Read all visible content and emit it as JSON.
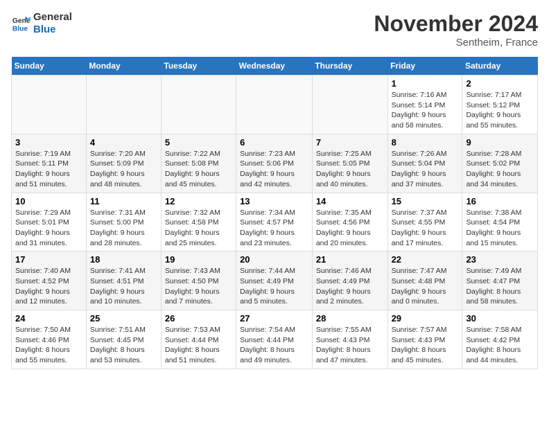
{
  "logo": {
    "line1": "General",
    "line2": "Blue"
  },
  "title": "November 2024",
  "location": "Sentheim, France",
  "days_of_week": [
    "Sunday",
    "Monday",
    "Tuesday",
    "Wednesday",
    "Thursday",
    "Friday",
    "Saturday"
  ],
  "weeks": [
    [
      {
        "num": "",
        "info": ""
      },
      {
        "num": "",
        "info": ""
      },
      {
        "num": "",
        "info": ""
      },
      {
        "num": "",
        "info": ""
      },
      {
        "num": "",
        "info": ""
      },
      {
        "num": "1",
        "info": "Sunrise: 7:16 AM\nSunset: 5:14 PM\nDaylight: 9 hours and 58 minutes."
      },
      {
        "num": "2",
        "info": "Sunrise: 7:17 AM\nSunset: 5:12 PM\nDaylight: 9 hours and 55 minutes."
      }
    ],
    [
      {
        "num": "3",
        "info": "Sunrise: 7:19 AM\nSunset: 5:11 PM\nDaylight: 9 hours and 51 minutes."
      },
      {
        "num": "4",
        "info": "Sunrise: 7:20 AM\nSunset: 5:09 PM\nDaylight: 9 hours and 48 minutes."
      },
      {
        "num": "5",
        "info": "Sunrise: 7:22 AM\nSunset: 5:08 PM\nDaylight: 9 hours and 45 minutes."
      },
      {
        "num": "6",
        "info": "Sunrise: 7:23 AM\nSunset: 5:06 PM\nDaylight: 9 hours and 42 minutes."
      },
      {
        "num": "7",
        "info": "Sunrise: 7:25 AM\nSunset: 5:05 PM\nDaylight: 9 hours and 40 minutes."
      },
      {
        "num": "8",
        "info": "Sunrise: 7:26 AM\nSunset: 5:04 PM\nDaylight: 9 hours and 37 minutes."
      },
      {
        "num": "9",
        "info": "Sunrise: 7:28 AM\nSunset: 5:02 PM\nDaylight: 9 hours and 34 minutes."
      }
    ],
    [
      {
        "num": "10",
        "info": "Sunrise: 7:29 AM\nSunset: 5:01 PM\nDaylight: 9 hours and 31 minutes."
      },
      {
        "num": "11",
        "info": "Sunrise: 7:31 AM\nSunset: 5:00 PM\nDaylight: 9 hours and 28 minutes."
      },
      {
        "num": "12",
        "info": "Sunrise: 7:32 AM\nSunset: 4:58 PM\nDaylight: 9 hours and 25 minutes."
      },
      {
        "num": "13",
        "info": "Sunrise: 7:34 AM\nSunset: 4:57 PM\nDaylight: 9 hours and 23 minutes."
      },
      {
        "num": "14",
        "info": "Sunrise: 7:35 AM\nSunset: 4:56 PM\nDaylight: 9 hours and 20 minutes."
      },
      {
        "num": "15",
        "info": "Sunrise: 7:37 AM\nSunset: 4:55 PM\nDaylight: 9 hours and 17 minutes."
      },
      {
        "num": "16",
        "info": "Sunrise: 7:38 AM\nSunset: 4:54 PM\nDaylight: 9 hours and 15 minutes."
      }
    ],
    [
      {
        "num": "17",
        "info": "Sunrise: 7:40 AM\nSunset: 4:52 PM\nDaylight: 9 hours and 12 minutes."
      },
      {
        "num": "18",
        "info": "Sunrise: 7:41 AM\nSunset: 4:51 PM\nDaylight: 9 hours and 10 minutes."
      },
      {
        "num": "19",
        "info": "Sunrise: 7:43 AM\nSunset: 4:50 PM\nDaylight: 9 hours and 7 minutes."
      },
      {
        "num": "20",
        "info": "Sunrise: 7:44 AM\nSunset: 4:49 PM\nDaylight: 9 hours and 5 minutes."
      },
      {
        "num": "21",
        "info": "Sunrise: 7:46 AM\nSunset: 4:49 PM\nDaylight: 9 hours and 2 minutes."
      },
      {
        "num": "22",
        "info": "Sunrise: 7:47 AM\nSunset: 4:48 PM\nDaylight: 9 hours and 0 minutes."
      },
      {
        "num": "23",
        "info": "Sunrise: 7:49 AM\nSunset: 4:47 PM\nDaylight: 8 hours and 58 minutes."
      }
    ],
    [
      {
        "num": "24",
        "info": "Sunrise: 7:50 AM\nSunset: 4:46 PM\nDaylight: 8 hours and 55 minutes."
      },
      {
        "num": "25",
        "info": "Sunrise: 7:51 AM\nSunset: 4:45 PM\nDaylight: 8 hours and 53 minutes."
      },
      {
        "num": "26",
        "info": "Sunrise: 7:53 AM\nSunset: 4:44 PM\nDaylight: 8 hours and 51 minutes."
      },
      {
        "num": "27",
        "info": "Sunrise: 7:54 AM\nSunset: 4:44 PM\nDaylight: 8 hours and 49 minutes."
      },
      {
        "num": "28",
        "info": "Sunrise: 7:55 AM\nSunset: 4:43 PM\nDaylight: 8 hours and 47 minutes."
      },
      {
        "num": "29",
        "info": "Sunrise: 7:57 AM\nSunset: 4:43 PM\nDaylight: 8 hours and 45 minutes."
      },
      {
        "num": "30",
        "info": "Sunrise: 7:58 AM\nSunset: 4:42 PM\nDaylight: 8 hours and 44 minutes."
      }
    ]
  ]
}
